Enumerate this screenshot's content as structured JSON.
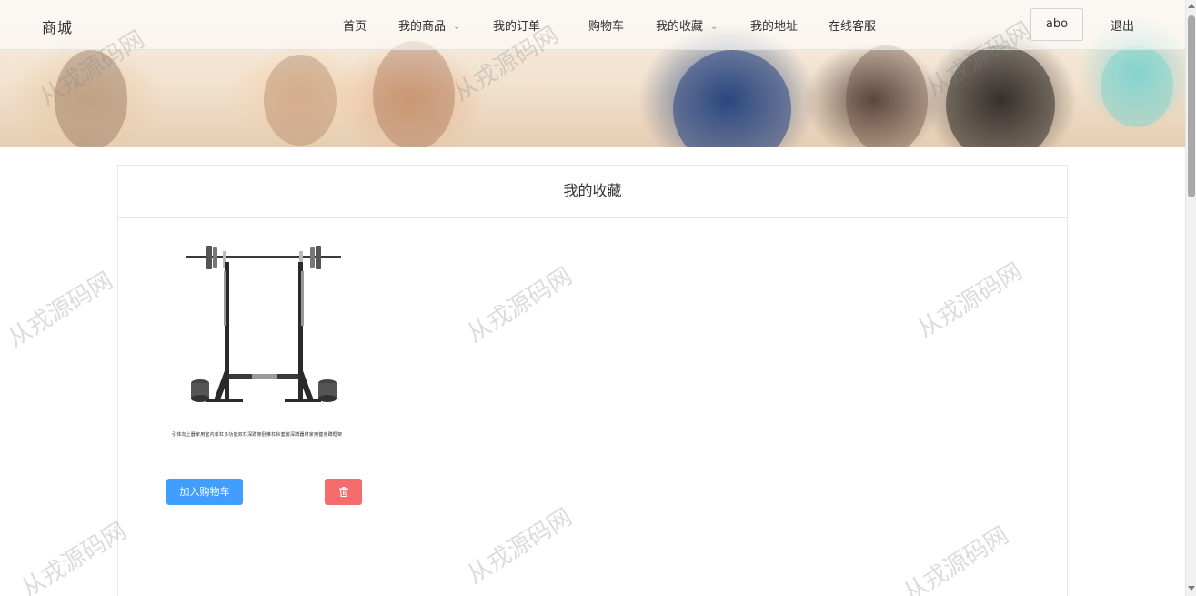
{
  "header": {
    "brand": "商城",
    "nav": [
      {
        "label": "首页",
        "has_dropdown": false
      },
      {
        "label": "我的商品",
        "has_dropdown": true
      },
      {
        "label": "我的订单",
        "has_dropdown": false
      },
      {
        "label": "购物车",
        "has_dropdown": false
      },
      {
        "label": "我的收藏",
        "has_dropdown": true
      },
      {
        "label": "我的地址",
        "has_dropdown": false
      },
      {
        "label": "在线客服",
        "has_dropdown": false
      }
    ],
    "username": "abo",
    "logout_label": "退出",
    "chevron_icon": "chevron-down-icon"
  },
  "main": {
    "title": "我的收藏",
    "favorites": [
      {
        "name": "引体向上器家用室内单杠多功能双杠深蹲架卧推杠铃套装深蹲器材家用健身蹲框架",
        "image_icon": "squat-rack-image",
        "add_to_cart_label": "加入购物车",
        "delete_icon": "trash-icon"
      }
    ]
  },
  "watermark": "从戎源码网",
  "colors": {
    "primary": "#409eff",
    "danger": "#f56c6c",
    "border": "#e4e7ed",
    "text": "#303133"
  }
}
